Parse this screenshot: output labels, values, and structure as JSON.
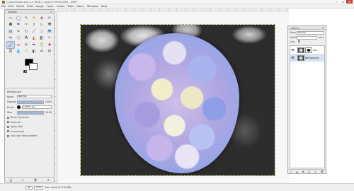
{
  "window": {
    "title": "[Colors\\photo.png-3.0 (RGB, 2 layers) 2592x1936 – GIMP",
    "controls": {
      "minimize": "–",
      "maximize": "▫",
      "close": "✕"
    }
  },
  "menubar": {
    "items": [
      "File",
      "Edit",
      "Select",
      "View",
      "Image",
      "Layer",
      "Colors",
      "Tools",
      "Filters",
      "Windows",
      "Help"
    ]
  },
  "toolbox": {
    "title": "Toolbox",
    "close": "×",
    "tools": [
      {
        "name": "rect-select-icon",
        "glyph": "▭",
        "color": "#5a6fa8"
      },
      {
        "name": "ellipse-select-icon",
        "glyph": "◯",
        "color": "#5a6fa8"
      },
      {
        "name": "free-select-icon",
        "glyph": "✎",
        "color": "#6a5a3a"
      },
      {
        "name": "fuzzy-select-icon",
        "glyph": "✦",
        "color": "#c79a2a"
      },
      {
        "name": "color-select-icon",
        "glyph": "◈",
        "color": "#b84a4a"
      },
      {
        "name": "scissors-icon",
        "glyph": "✂",
        "color": "#555555"
      },
      {
        "name": "foreground-select-icon",
        "glyph": "☗",
        "color": "#4a7a4a"
      },
      {
        "name": "paths-icon",
        "glyph": "✒",
        "color": "#444444"
      },
      {
        "name": "color-picker-icon",
        "glyph": "✑",
        "color": "#666666"
      },
      {
        "name": "zoom-icon",
        "glyph": "⌕",
        "color": "#444444"
      },
      {
        "name": "measure-icon",
        "glyph": "⊾",
        "color": "#777777"
      },
      {
        "name": "move-icon",
        "glyph": "✥",
        "color": "#333333"
      },
      {
        "name": "align-icon",
        "glyph": "▤",
        "color": "#4a6fae"
      },
      {
        "name": "crop-icon",
        "glyph": "⌗",
        "color": "#8a5a2a"
      },
      {
        "name": "rotate-icon",
        "glyph": "↻",
        "color": "#3a7ab8"
      },
      {
        "name": "scale-icon",
        "glyph": "⤢",
        "color": "#3a7ab8"
      },
      {
        "name": "shear-icon",
        "glyph": "▱",
        "color": "#3a7ab8"
      },
      {
        "name": "perspective-icon",
        "glyph": "⬒",
        "color": "#3a7ab8"
      },
      {
        "name": "flip-icon",
        "glyph": "⇋",
        "color": "#555555"
      },
      {
        "name": "cage-icon",
        "glyph": "⬡",
        "color": "#6a6a6a"
      },
      {
        "name": "text-icon",
        "glyph": "A",
        "color": "#222222"
      },
      {
        "name": "bucket-fill-icon",
        "glyph": "◭",
        "color": "#c24a3a"
      },
      {
        "name": "blend-icon",
        "glyph": "◧",
        "color": "#777777"
      },
      {
        "name": "pencil-icon",
        "glyph": "✏",
        "color": "#c98a2a"
      },
      {
        "name": "paintbrush-icon",
        "glyph": "🖌",
        "color": "#8a5a2a"
      },
      {
        "name": "eraser-icon",
        "glyph": "▰",
        "color": "#d07a9a"
      },
      {
        "name": "airbrush-icon",
        "glyph": "✈",
        "color": "#6a6a6a"
      },
      {
        "name": "ink-icon",
        "glyph": "✒",
        "color": "#2a2a7a"
      },
      {
        "name": "clone-icon",
        "glyph": "⎘",
        "color": "#b8862a"
      },
      {
        "name": "heal-icon",
        "glyph": "✚",
        "color": "#b84a4a"
      },
      {
        "name": "perspective-clone-icon",
        "glyph": "⧉",
        "color": "#7a5a2a"
      },
      {
        "name": "blur-sharpen-icon",
        "glyph": "💧",
        "color": "#3a6ab8"
      },
      {
        "name": "smudge-icon",
        "glyph": "☝",
        "color": "#8a6a4a"
      },
      {
        "name": "dodge-burn-icon",
        "glyph": "◐",
        "color": "#555555"
      },
      {
        "name": "mypaint-brush-icon",
        "glyph": "✍",
        "color": "#4a4a4a"
      },
      {
        "name": "gegl-icon",
        "glyph": "⚙",
        "color": "#666666"
      }
    ],
    "active_tool_index": 24
  },
  "tool_options": {
    "title": "Paintbrush",
    "mode_label": "Mode",
    "mode_value": "Normal",
    "opacity_label": "Opacity",
    "opacity_value": "100.0",
    "brush_label": "Brush",
    "brush_value": "Circle (11)",
    "size_label": "Size",
    "size_value": "20.00",
    "options": [
      "Brush Dynamics",
      "Fade out",
      "Apply Jitter",
      "Incremental",
      "Use color from gradient"
    ]
  },
  "toolbox_bottom": [
    "⎙",
    "↶",
    "🗑",
    "↺"
  ],
  "layers": {
    "title": "Layers",
    "close": "×",
    "mode_label": "Mode",
    "mode_value": "Normal",
    "opacity_label": "Opacity",
    "opacity_value": "100.0",
    "lock_label": "Lock",
    "items": [
      {
        "name": "blur",
        "visible": true,
        "has_mask": true
      },
      {
        "name": "Background",
        "visible": true,
        "has_mask": false
      }
    ],
    "bottom_buttons": [
      "▫",
      "▲",
      "▼",
      "⧉",
      "⚓",
      "🗑"
    ]
  },
  "status": {
    "unit": "px",
    "zoom": "11%",
    "text": "blur mask (117.6 MB)"
  }
}
